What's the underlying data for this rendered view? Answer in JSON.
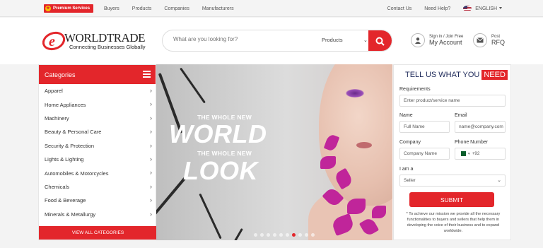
{
  "topbar": {
    "premium_label": "Premium Services",
    "nav": [
      "Buyers",
      "Products",
      "Companies",
      "Manufacturers"
    ],
    "contact": "Contact Us",
    "help": "Need Help?",
    "language": "ENGLISH"
  },
  "header": {
    "logo_title": "WORLDTRADE",
    "logo_tagline": "Connecting Businesses Globally",
    "search_placeholder": "What are you looking for?",
    "search_category": "Products",
    "signin_small": "Sign in / Join Free",
    "account_label": "My Account",
    "post_small": "Post",
    "rfq_label": "RFQ"
  },
  "categories": {
    "title": "Categories",
    "items": [
      "Apparel",
      "Home Appliances",
      "Machinery",
      "Beauty & Personal Care",
      "Security & Protection",
      "Lights & Lighting",
      "Automobiles  & Motorcycles",
      "Chemicals",
      "Food & Beverage",
      "Minerals & Metallurgy"
    ],
    "view_all": "VIEW ALL CATEGORIES"
  },
  "banner": {
    "line1_small": "THE WHOLE NEW",
    "line1_big": "WORLD",
    "line2_small": "THE WHOLE NEW",
    "line2_big": "LOOK",
    "slide_count": 10,
    "active_slide": 6
  },
  "form": {
    "title_prefix": "TELL US WHAT YOU",
    "title_highlight": "NEED",
    "requirements_label": "Requirements",
    "requirements_placeholder": "Enter product/service name",
    "name_label": "Name",
    "name_placeholder": "Full Name",
    "email_label": "Email",
    "email_placeholder": "name@company.com",
    "company_label": "Company",
    "company_placeholder": "Company Name",
    "phone_label": "Phone Number",
    "phone_code": "+92",
    "role_label": "I am a",
    "role_value": "Seller",
    "submit": "SUBMIT",
    "note": "* To achieve our mission we provide all the necessary functionalities to buyers and sellers that help them in developing the voice of their business and to expand worldwide."
  },
  "colors": {
    "brand_red": "#e3262b",
    "navy": "#1e2a5a"
  }
}
